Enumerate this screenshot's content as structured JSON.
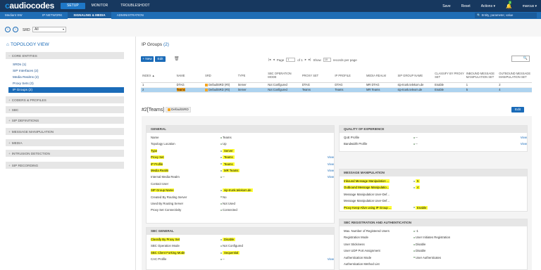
{
  "brand": {
    "pre": "c",
    "name": "audiocodes"
  },
  "topnav": [
    "SETUP",
    "MONITOR",
    "TROUBLESHOOT"
  ],
  "topright": {
    "save": "Save",
    "reset": "Reset",
    "actions": "Actions ▾",
    "bell_count": "2",
    "user": "marcus ▾"
  },
  "subbar": {
    "device": "Mediant SW",
    "tabs": [
      "IP NETWORK",
      "SIGNALING & MEDIA",
      "ADMINISTRATION"
    ],
    "search_placeholder": "Entity, parameter, value"
  },
  "srd": {
    "label": "SRD",
    "value": "All"
  },
  "sidebar": {
    "title": "TOPOLOGY VIEW",
    "core": "CORE ENTITIES",
    "items": [
      "SRDs (1)",
      "SIP Interfaces (2)",
      "Media Realms (2)",
      "Proxy Sets (3)",
      "IP Groups (2)"
    ],
    "sections": [
      "CODERS & PROFILES",
      "SBC",
      "SIP DEFINITIONS",
      "MESSAGE MANIPULATION",
      "MEDIA",
      "INTRUSION DETECTION",
      "SIP RECORDING"
    ]
  },
  "main": {
    "title": "IP Groups",
    "count": "(2)",
    "new": "+ New",
    "edit": "Edit"
  },
  "pager": {
    "page": "Page",
    "num": "1",
    "of": "of 1",
    "show": "Show",
    "per": "10",
    "records": "records per page"
  },
  "table": {
    "headers": [
      "INDEX ▲",
      "NAME",
      "SRD",
      "TYPE",
      "SBC OPERATION MODE",
      "PROXY SET",
      "IP PROFILE",
      "MEDIA REALM",
      "SIP GROUP NAME",
      "CLASSIFY BY PROXY SET",
      "INBOUND MESSAGE MANIPULATION SET",
      "OUTBOUND MESSAGE MANIPULATION SET"
    ],
    "rows": [
      [
        "1",
        "DTAG",
        "DefaultSRD (#0)",
        "Server",
        "Not Configured",
        "DTAG",
        "DTAG",
        "MR DTAG",
        "sip-trunk.telekom.de",
        "Enable",
        "1",
        "2"
      ],
      [
        "2",
        "Teams",
        "DefaultSRD (#0)",
        "Server",
        "Not Configured",
        "Teams",
        "Teams",
        "MR Teams",
        "sip-trunk.teleom.de",
        "Enable",
        "5",
        "4"
      ]
    ]
  },
  "detail": {
    "title": "#2[Teams]",
    "srd": "DefaultSRD",
    "edit": "Edit"
  },
  "general": {
    "header": "GENERAL",
    "rows": [
      {
        "k": "Name",
        "v": "Teams"
      },
      {
        "k": "Topology Location",
        "v": "Up"
      },
      {
        "k": "Type",
        "v": "Server"
      },
      {
        "k": "Proxy Set",
        "v": "Teams",
        "l": "View"
      },
      {
        "k": "IP Profile",
        "v": "Teams",
        "l": "View"
      },
      {
        "k": "Media Realm",
        "v": "MR Teams",
        "l": "View"
      },
      {
        "k": "Internal Media Realm",
        "v": "--",
        "l": "View"
      },
      {
        "k": "Contact User",
        "v": ""
      },
      {
        "k": "SIP Group Name",
        "v": "sip-trunk.telekom.de"
      },
      {
        "k": "Created By Routing Server",
        "v": "No"
      },
      {
        "k": "Used By Routing Server",
        "v": "Not Used"
      },
      {
        "k": "Proxy Set Connectivity",
        "v": "Connected"
      }
    ]
  },
  "sbcgeneral": {
    "header": "SBC GENERAL",
    "rows": [
      {
        "k": "Classify By Proxy Set",
        "v": "Disable"
      },
      {
        "k": "SBC Operation Mode",
        "v": "Not Configured"
      },
      {
        "k": "SBC Client Forking Mode",
        "v": "Sequential"
      },
      {
        "k": "CAC Profile",
        "v": "--",
        "l": "View"
      }
    ]
  },
  "qoe": {
    "header": "QUALITY OF EXPERIENCE",
    "rows": [
      {
        "k": "QoE Profile",
        "v": "--",
        "l": "View"
      },
      {
        "k": "Bandwidth Profile",
        "v": "--",
        "l": "View"
      }
    ]
  },
  "msgmanip": {
    "header": "MESSAGE MANIPULATION",
    "rows": [
      {
        "k": "Inbound Message Manipulation ...",
        "v": "5"
      },
      {
        "k": "Outbound Message Manipulatio...",
        "v": "4"
      },
      {
        "k": "Message Manipulation User-Def...",
        "v": ""
      },
      {
        "k": "Message Manipulation User-Def...",
        "v": ""
      },
      {
        "k": "Proxy Keep-Alive using IP Group ...",
        "v": "Enable"
      }
    ]
  },
  "sbcreg": {
    "header": "SBC REGISTRATION AND AUTHENTICATION",
    "rows": [
      {
        "k": "Max. Number of Registered Users",
        "v": "-1"
      },
      {
        "k": "Registration Mode",
        "v": "User Initiates Registration"
      },
      {
        "k": "User Stickiness",
        "v": "Disable"
      },
      {
        "k": "User UDP Port Assignment",
        "v": "Disable"
      },
      {
        "k": "Authentication Mode",
        "v": "User Authenticates"
      },
      {
        "k": "Authentication Method List",
        "v": ""
      }
    ]
  }
}
